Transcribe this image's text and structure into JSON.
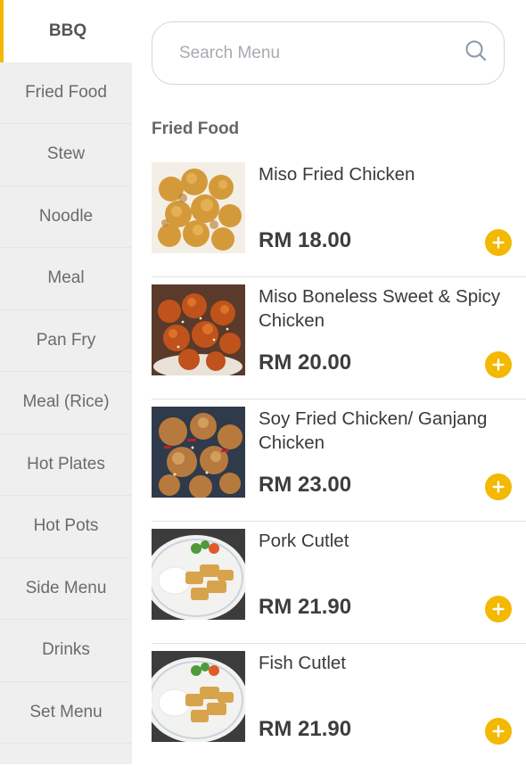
{
  "sidebar": {
    "categories": [
      {
        "label": "BBQ"
      },
      {
        "label": "Fried Food"
      },
      {
        "label": "Stew"
      },
      {
        "label": "Noodle"
      },
      {
        "label": "Meal"
      },
      {
        "label": "Pan Fry"
      },
      {
        "label": "Meal (Rice)"
      },
      {
        "label": "Hot Plates"
      },
      {
        "label": "Hot Pots"
      },
      {
        "label": "Side Menu"
      },
      {
        "label": "Drinks"
      },
      {
        "label": "Set Menu"
      }
    ],
    "active_index": 0
  },
  "search": {
    "placeholder": "Search Menu",
    "icon": "search-icon"
  },
  "section": {
    "title": "Fried Food"
  },
  "items": [
    {
      "name": "Miso Fried Chicken",
      "price": "RM 18.00"
    },
    {
      "name": "Miso Boneless Sweet & Spicy Chicken",
      "price": "RM 20.00"
    },
    {
      "name": "Soy Fried Chicken/ Ganjang Chicken",
      "price": "RM 23.00"
    },
    {
      "name": "Pork Cutlet",
      "price": "RM 21.90"
    },
    {
      "name": "Fish Cutlet",
      "price": "RM 21.90"
    }
  ],
  "colors": {
    "accent": "#f3b800",
    "sidebar_bg": "#efefef"
  }
}
